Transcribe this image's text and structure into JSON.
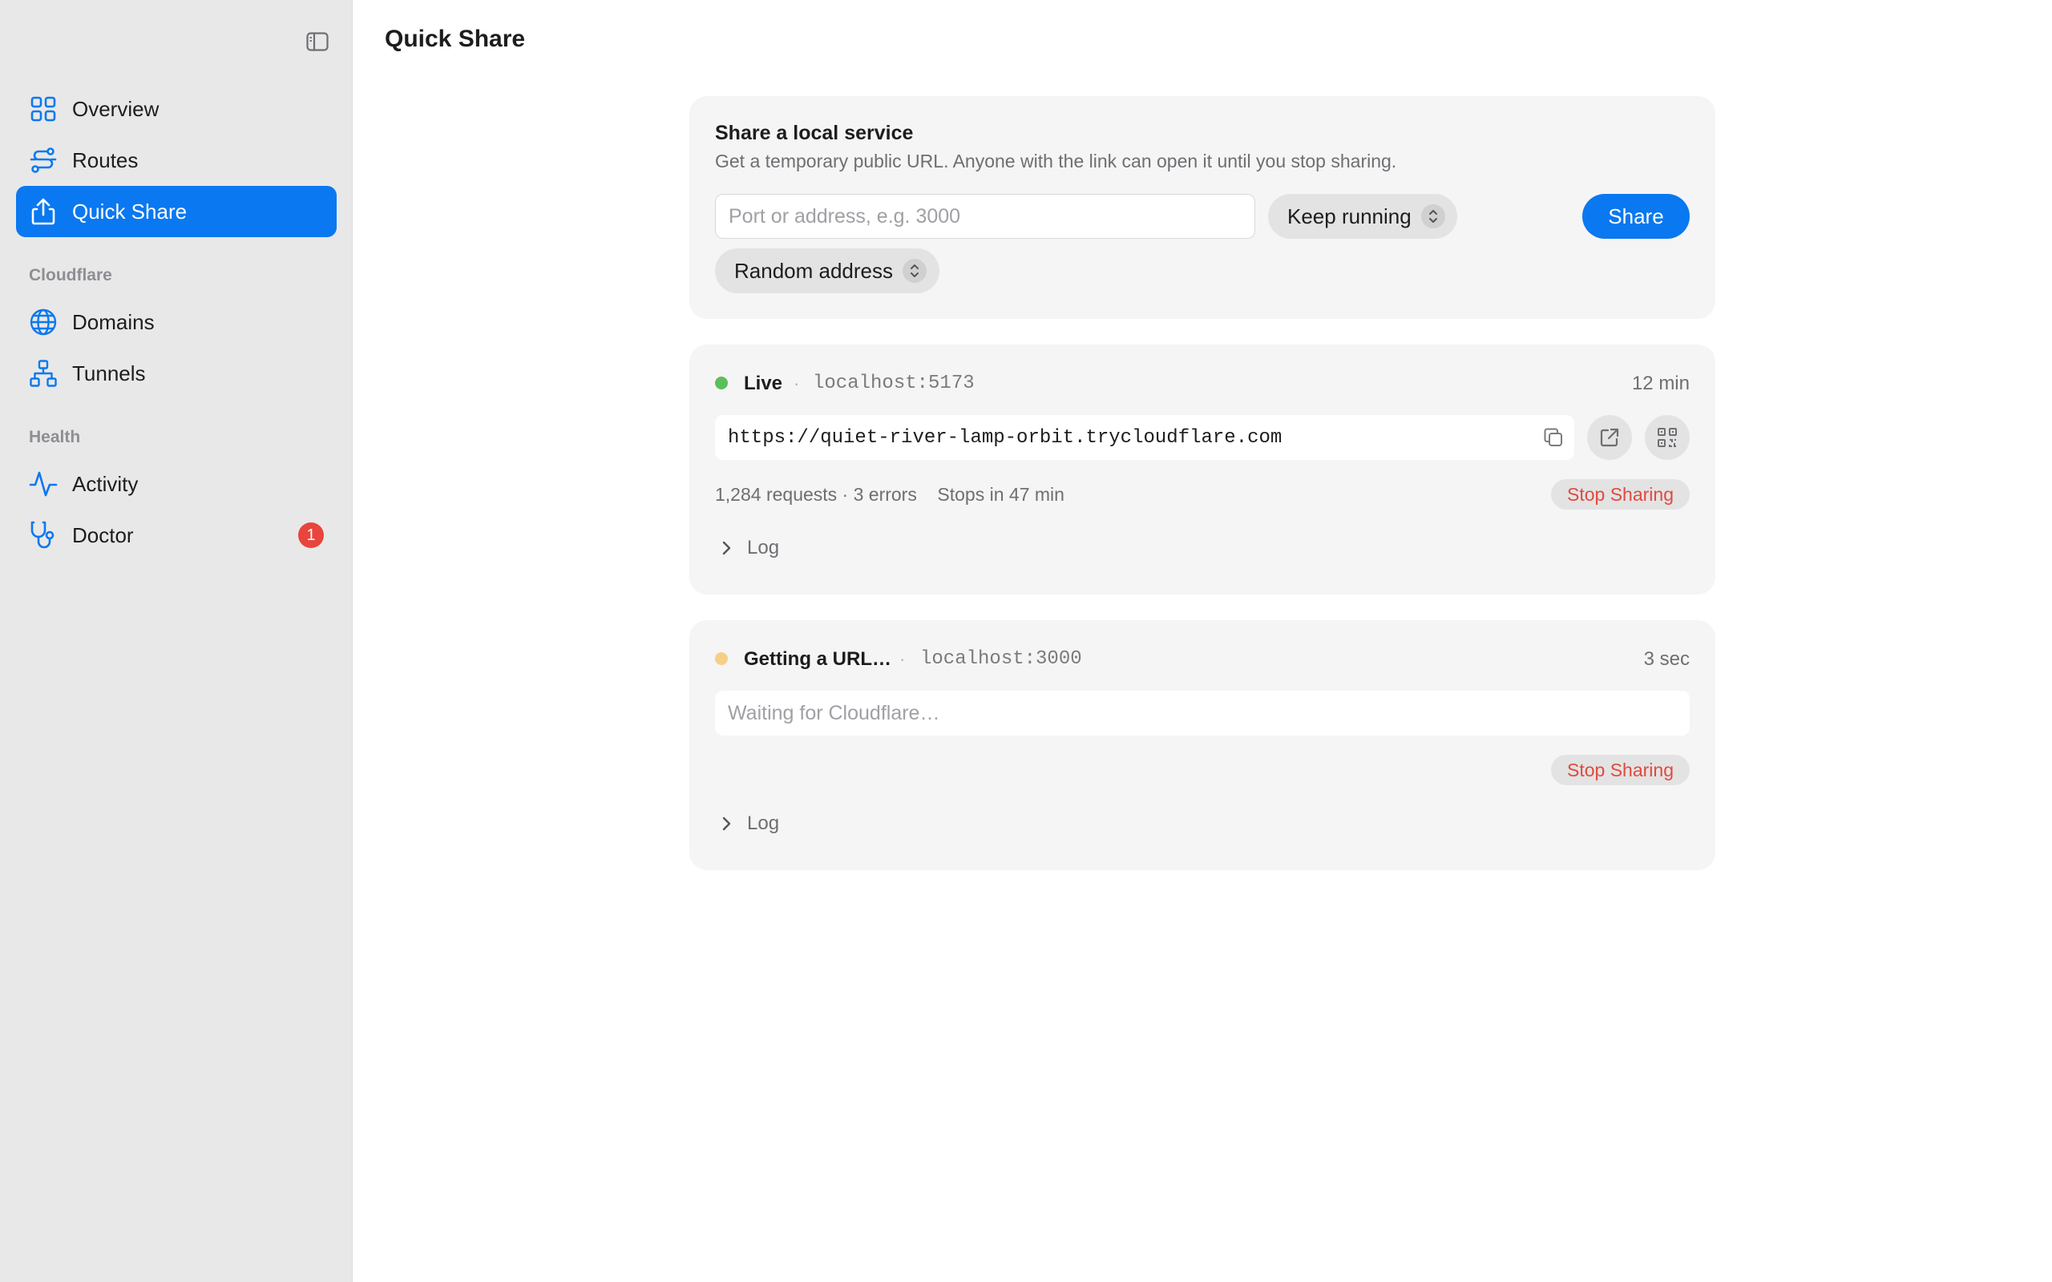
{
  "sidebar": {
    "toggle_icon": "sidebar-toggle-icon",
    "accent": "#0a78f0",
    "items": [
      {
        "label": "Overview",
        "icon": "grid-icon"
      },
      {
        "label": "Routes",
        "icon": "routes-icon"
      },
      {
        "label": "Quick Share",
        "icon": "share-icon",
        "active": true
      }
    ],
    "sections": [
      {
        "title": "Cloudflare",
        "items": [
          {
            "label": "Domains",
            "icon": "globe-icon"
          },
          {
            "label": "Tunnels",
            "icon": "network-icon"
          }
        ]
      },
      {
        "title": "Health",
        "items": [
          {
            "label": "Activity",
            "icon": "activity-icon"
          },
          {
            "label": "Doctor",
            "icon": "stethoscope-icon",
            "badge": "1"
          }
        ]
      }
    ]
  },
  "main": {
    "title": "Quick Share",
    "share_form": {
      "title": "Share a local service",
      "subtitle": "Get a temporary public URL. Anyone with the link can open it until you stop sharing.",
      "input_placeholder": "Port or address, e.g. 3000",
      "duration_select": "Keep running",
      "address_select": "Random address",
      "share_label": "Share"
    },
    "shares": [
      {
        "status": "Live",
        "status_color": "#5cbf5c",
        "separator": "·",
        "address": "localhost:5173",
        "elapsed": "12 min",
        "url": "https://quiet-river-lamp-orbit.trycloudflare.com",
        "stats": "1,284 requests · 3 errors    Stops in 47 min",
        "stop_label": "Stop Sharing",
        "log_label": "Log"
      },
      {
        "status": "Getting a URL…",
        "status_color": "#f5cf86",
        "separator": "·",
        "address": "localhost:3000",
        "elapsed": "3 sec",
        "url_placeholder": "Waiting for Cloudflare…",
        "stop_label": "Stop Sharing",
        "log_label": "Log"
      }
    ]
  },
  "colors": {
    "stop_text": "#e04a3f",
    "badge": "#e8453c"
  }
}
